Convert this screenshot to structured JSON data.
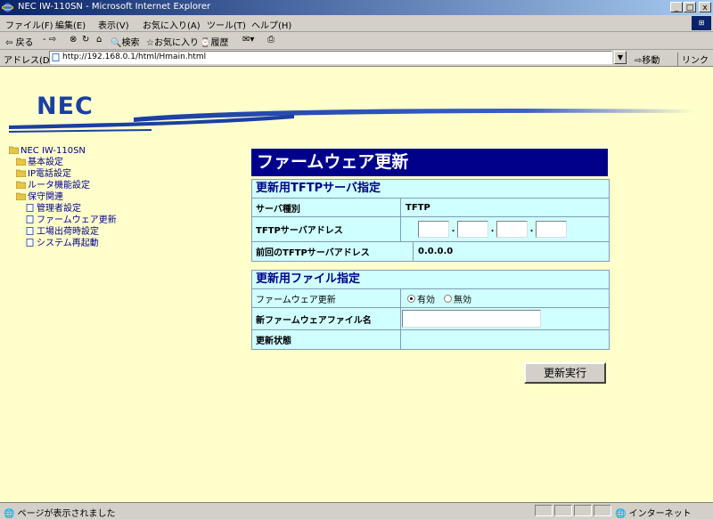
{
  "window": {
    "title": "NEC IW-110SN - Microsoft Internet Explorer",
    "min": "_",
    "max": "□",
    "close": "x"
  },
  "menu": [
    "ファイル(F)",
    "編集(E)",
    "表示(V)",
    "お気に入り(A)",
    "ツール(T)",
    "ヘルプ(H)"
  ],
  "toolbar": {
    "back": "戻る",
    "search": "検索",
    "favorites": "お気に入り",
    "history": "履歴"
  },
  "address": {
    "label": "アドレス(D)",
    "url": "http://192.168.0.1/html/Hmain.html",
    "go": "移動",
    "links": "リンク"
  },
  "logo": "NEC",
  "tree": [
    {
      "label": "NEC IW-110SN",
      "icon": "folder-open-icon",
      "depth": 0
    },
    {
      "label": "基本設定",
      "icon": "folder-icon",
      "depth": 1
    },
    {
      "label": "IP電話設定",
      "icon": "folder-icon",
      "depth": 1
    },
    {
      "label": "ルータ機能設定",
      "icon": "folder-icon",
      "depth": 1
    },
    {
      "label": "保守関連",
      "icon": "folder-open-icon",
      "depth": 1
    },
    {
      "label": "管理者設定",
      "icon": "page-icon",
      "depth": 2
    },
    {
      "label": "ファームウェア更新",
      "icon": "page-icon",
      "depth": 2
    },
    {
      "label": "工場出荷時設定",
      "icon": "page-icon",
      "depth": 2
    },
    {
      "label": "システム再起動",
      "icon": "page-icon",
      "depth": 2
    }
  ],
  "page": {
    "title": "ファームウェア更新",
    "tftp_section": {
      "heading": "更新用TFTPサーバ指定",
      "server_type_label": "サーバ種別",
      "server_type_value": "TFTP",
      "address_label": "TFTPサーバアドレス",
      "address_octets": [
        "",
        "",
        "",
        ""
      ],
      "previous_label": "前回のTFTPサーバアドレス",
      "previous_value": "0.0.0.0"
    },
    "file_section": {
      "heading": "更新用ファイル指定",
      "update_label": "ファームウェア更新",
      "enabled_label": "有効",
      "disabled_label": "無効",
      "selected": "enabled",
      "filename_label": "新ファームウェアファイル名",
      "filename_value": "",
      "status_label": "更新状態",
      "status_value": ""
    },
    "execute_button": "更新実行"
  },
  "status": {
    "text": "ページが表示されました",
    "zone": "インターネット"
  },
  "colors": {
    "banner": "#00008b",
    "panel": "#d0ffff",
    "content_bg": "#ffffcc",
    "logo": "#1a3fa3"
  }
}
